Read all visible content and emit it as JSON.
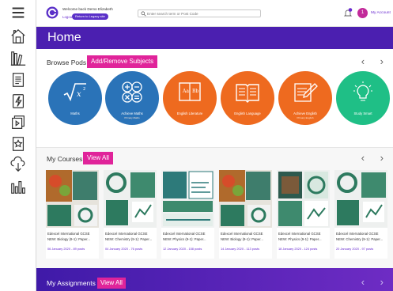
{
  "topbar": {
    "welcome": "Welcome back Demo Elizabeth",
    "logout": "Logout",
    "return_button": "Return to Legacy site",
    "search_placeholder": "Enter search term or Post Code",
    "account_link": "My Account",
    "notification_count": "1"
  },
  "header": {
    "title": "Home"
  },
  "browse": {
    "label": "Browse Pods",
    "button": "Add/Remove Subjects",
    "pods": [
      {
        "label": "Maths",
        "sub": "",
        "color": "#2a73b8",
        "icon": "sqrt-icon"
      },
      {
        "label": "Achieve Maths",
        "sub": "Primary Maths",
        "color": "#2a73b8",
        "icon": "math-operators-icon"
      },
      {
        "label": "English Literature",
        "sub": "",
        "color": "#ee6a1f",
        "icon": "book-icon"
      },
      {
        "label": "English Language",
        "sub": "",
        "color": "#ee6a1f",
        "icon": "open-book-icon"
      },
      {
        "label": "Achieve English",
        "sub": "Primary English",
        "color": "#ee6a1f",
        "icon": "pen-paper-icon"
      },
      {
        "label": "Study Smart",
        "sub": "",
        "color": "#1fbf86",
        "icon": "lightbulb-icon"
      }
    ]
  },
  "courses": {
    "label": "My Courses",
    "button": "View All",
    "cards": [
      {
        "title": "Edexcel International GCSE NEW: Biology (9-1): Paper...",
        "date": "06 January 2020 - 89 posts"
      },
      {
        "title": "Edexcel International GCSE NEW: Chemistry (9-1): Paper...",
        "date": "04 January 2020 - 76 posts"
      },
      {
        "title": "Edexcel International GCSE NEW: Physics (9-1): Paper...",
        "date": "12 January 2020 - 158 posts"
      },
      {
        "title": "Edexcel International GCSE NEW: Biology (9-1): Paper...",
        "date": "14 January 2020 - 113 posts"
      },
      {
        "title": "Edexcel International GCSE NEW: Physics (9-1): Paper...",
        "date": "18 January 2020 - 124 posts"
      },
      {
        "title": "Edexcel International GCSE NEW: Chemistry (9-1): Paper...",
        "date": "20 January 2020 - 97 posts"
      }
    ]
  },
  "assignments": {
    "label": "My Assignments",
    "button": "View All"
  },
  "colors": {
    "brand_purple": "#4b1fb0",
    "accent_pink": "#e0249a",
    "maths_blue": "#2a73b8",
    "english_orange": "#ee6a1f",
    "study_green": "#1fbf86"
  }
}
